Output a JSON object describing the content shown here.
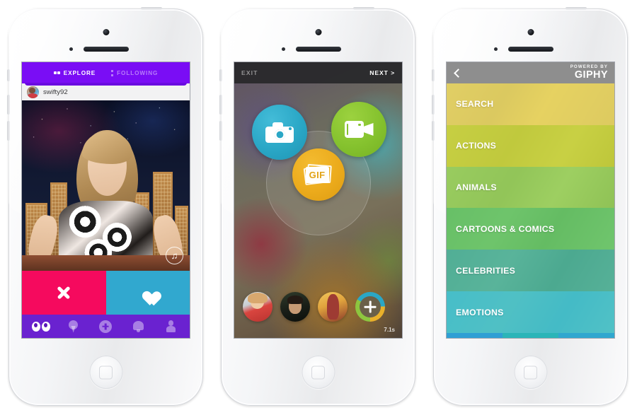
{
  "phones": {
    "phone1": {
      "name": "social-feed-app",
      "tabs": [
        {
          "label": "EXPLORE",
          "icon": "eyes-icon",
          "active": true
        },
        {
          "label": "FOLLOWING",
          "icon": "vertical-dots-icon",
          "active": false
        }
      ],
      "post": {
        "username": "swifty92",
        "avatar_alt": "user-avatar",
        "media_alt": "celebrity-talk-show-clip",
        "music_icon": "music-note-icon"
      },
      "actions": [
        {
          "label": "Pass",
          "icon": "close-x-icon",
          "color": "#f50a5e"
        },
        {
          "label": "Like",
          "icon": "heart-icon",
          "color": "#31a8cf"
        }
      ],
      "navbar": {
        "background": "#6a22d0",
        "items": [
          {
            "name": "explore",
            "icon": "eyes-icon",
            "active": true
          },
          {
            "name": "nearby",
            "icon": "location-pin-icon",
            "active": false
          },
          {
            "name": "create",
            "icon": "plus-circle-icon",
            "active": false
          },
          {
            "name": "notifications",
            "icon": "bell-icon",
            "active": false
          },
          {
            "name": "profile",
            "icon": "person-icon",
            "active": false
          }
        ]
      }
    },
    "phone2": {
      "name": "capture-screen",
      "topbar": {
        "exit_label": "EXIT",
        "next_label": "NEXT >"
      },
      "capture_options": [
        {
          "label": "Photo",
          "icon": "camera-icon",
          "color": "#2aa7c6"
        },
        {
          "label": "Video",
          "icon": "video-camera-icon",
          "color": "#85c22e"
        },
        {
          "label": "GIF",
          "icon": "gif-icon",
          "text": "GIF",
          "color": "#ecab1c"
        }
      ],
      "tray": {
        "thumbnails": [
          {
            "alt": "clip-thumbnail-1"
          },
          {
            "alt": "clip-thumbnail-2"
          },
          {
            "alt": "clip-thumbnail-3"
          }
        ],
        "add_button": {
          "icon": "plus-icon",
          "label": "Add"
        },
        "duration": "7.1s"
      }
    },
    "phone3": {
      "name": "giphy-categories",
      "topbar": {
        "back_icon": "chevron-left-icon",
        "powered_by": "POWERED BY",
        "brand": "GIPHY"
      },
      "categories": [
        {
          "label": "SEARCH",
          "color": "#ecd343",
          "bg": "bg1"
        },
        {
          "label": "ACTIONS",
          "color": "#d2de1e",
          "bg": "bg2"
        },
        {
          "label": "ANIMALS",
          "color": "#8ed13c",
          "bg": "bg3"
        },
        {
          "label": "CARTOONS & COMICS",
          "color": "#48c04c",
          "bg": "bg4"
        },
        {
          "label": "CELEBRITIES",
          "color": "#33b392",
          "bg": "bg5"
        },
        {
          "label": "EMOTIONS",
          "color": "#21c0cd",
          "bg": "bg6"
        }
      ]
    }
  }
}
